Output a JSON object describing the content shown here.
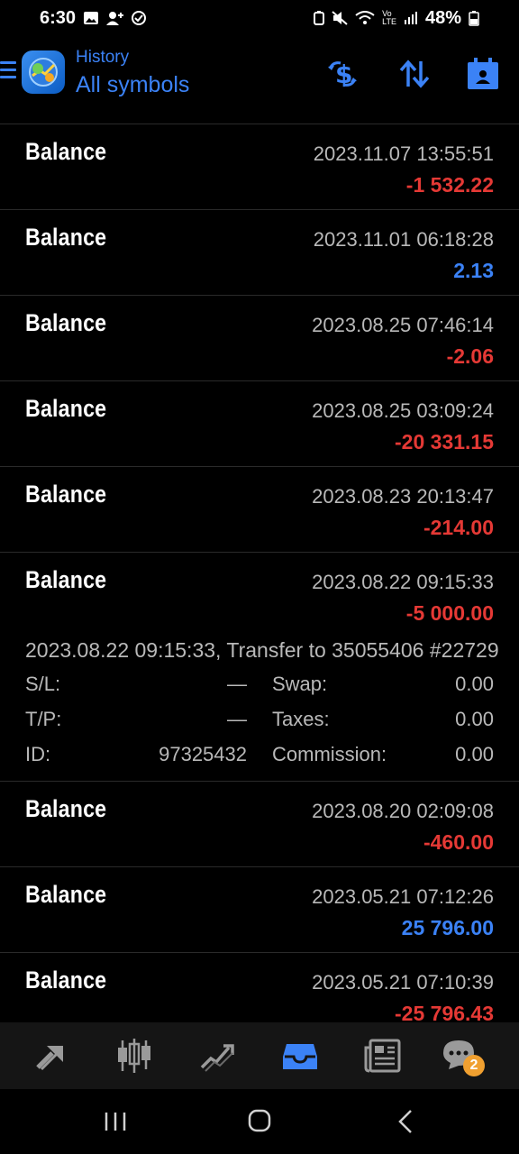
{
  "status_bar": {
    "time": "6:30",
    "battery": "48%",
    "left_icons": [
      "gallery-icon",
      "add-person-icon",
      "check-circle-icon"
    ],
    "right_icons": [
      "battery-saver-icon",
      "mute-icon",
      "wifi-icon",
      "volte-icon",
      "signal-icon",
      "battery-icon"
    ]
  },
  "header": {
    "subtitle": "History",
    "title": "All symbols",
    "accent_color": "#3b82f6",
    "actions": [
      "currency-exchange-icon",
      "sort-icon",
      "calendar-icon"
    ]
  },
  "transactions": [
    {
      "type": "Balance",
      "time": "2023.11.07 13:55:51",
      "amount": "-1 532.22",
      "sign": "neg"
    },
    {
      "type": "Balance",
      "time": "2023.11.01 06:18:28",
      "amount": "2.13",
      "sign": "pos"
    },
    {
      "type": "Balance",
      "time": "2023.08.25 07:46:14",
      "amount": "-2.06",
      "sign": "neg"
    },
    {
      "type": "Balance",
      "time": "2023.08.25 03:09:24",
      "amount": "-20 331.15",
      "sign": "neg"
    },
    {
      "type": "Balance",
      "time": "2023.08.23 20:13:47",
      "amount": "-214.00",
      "sign": "neg"
    },
    {
      "type": "Balance",
      "time": "2023.08.22 09:15:33",
      "amount": "-5 000.00",
      "sign": "neg",
      "expanded": true,
      "details": {
        "comment": "2023.08.22 09:15:33, Transfer to 35055406 #22729",
        "sl_label": "S/L:",
        "sl_value": "—",
        "tp_label": "T/P:",
        "tp_value": "—",
        "id_label": "ID:",
        "id_value": "97325432",
        "swap_label": "Swap:",
        "swap_value": "0.00",
        "taxes_label": "Taxes:",
        "taxes_value": "0.00",
        "commission_label": "Commission:",
        "commission_value": "0.00"
      }
    },
    {
      "type": "Balance",
      "time": "2023.08.20 02:09:08",
      "amount": "-460.00",
      "sign": "neg"
    },
    {
      "type": "Balance",
      "time": "2023.05.21 07:12:26",
      "amount": "25 796.00",
      "sign": "pos"
    },
    {
      "type": "Balance",
      "time": "2023.05.21 07:10:39",
      "amount": "-25 796.43",
      "sign": "neg"
    }
  ],
  "colors": {
    "negative": "#e53935",
    "positive": "#3b82f6",
    "muted": "#b9b9b9"
  },
  "bottom_nav": {
    "items": [
      "quotes-icon",
      "chart-icon",
      "trade-icon",
      "history-icon",
      "news-icon",
      "chat-icon"
    ],
    "active": "history-icon",
    "chat_badge": "2"
  },
  "system_nav": [
    "recents-icon",
    "home-icon",
    "back-icon"
  ]
}
